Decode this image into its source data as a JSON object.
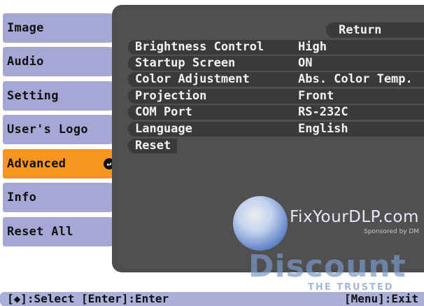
{
  "tabs": [
    {
      "label": "Image"
    },
    {
      "label": "Audio"
    },
    {
      "label": "Setting"
    },
    {
      "label": "User's Logo"
    },
    {
      "label": "Advanced",
      "active": true,
      "icon": "enter-icon"
    },
    {
      "label": "Info"
    },
    {
      "label": "Reset All"
    }
  ],
  "panel": {
    "return_label": "Return",
    "rows": [
      {
        "label": "Brightness Control",
        "value": "High"
      },
      {
        "label": "Startup Screen",
        "value": "ON"
      },
      {
        "label": "Color Adjustment",
        "value": "Abs. Color Temp."
      },
      {
        "label": "Projection",
        "value": "Front"
      },
      {
        "label": "COM Port",
        "value": "RS-232C"
      },
      {
        "label": "Language",
        "value": "English"
      },
      {
        "label": "Reset",
        "value": ""
      }
    ]
  },
  "watermark": {
    "site": "FixYourDLP.com",
    "sponsor": "Sponsored by DM",
    "big": "Discount",
    "sub": "THE TRUSTED"
  },
  "status": {
    "left": "[◆]:Select [Enter]:Enter",
    "right": "[Menu]:Exit"
  },
  "colors": {
    "tab": "#a7a7d6",
    "tab_active": "#f6951f",
    "panel": "#4d4d4d",
    "row": "#3a3a3a",
    "status_bar": "#aab0d8"
  }
}
